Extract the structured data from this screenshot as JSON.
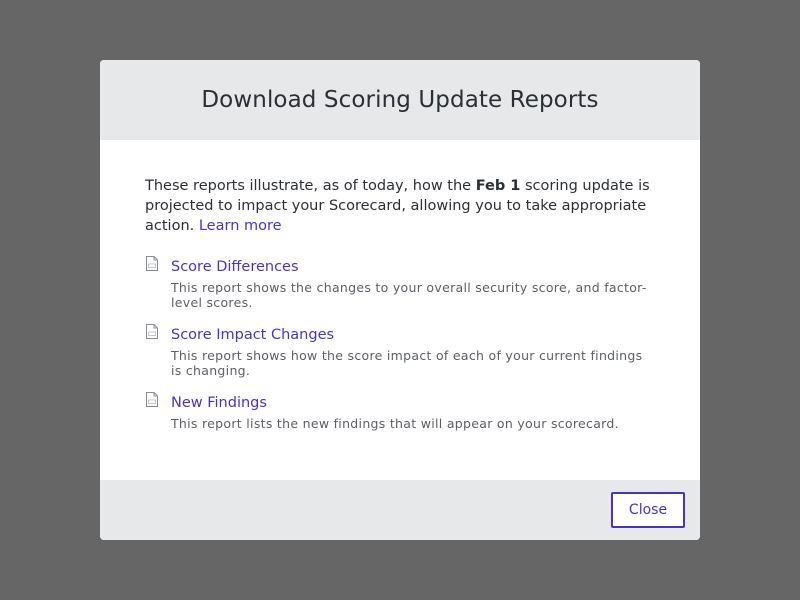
{
  "modal": {
    "title": "Download Scoring Update Reports",
    "intro_before": "These reports illustrate, as of today, how the ",
    "intro_bold": "Feb 1",
    "intro_after": " scoring update is projected to impact your Scorecard, allowing you to take appropriate action. ",
    "learn_more": "Learn more",
    "reports": [
      {
        "icon": "csv-file-icon",
        "label": "Score Differences",
        "description": "This report shows the changes to your overall security score, and factor-level scores."
      },
      {
        "icon": "csv-file-icon",
        "label": "Score Impact Changes",
        "description": "This report shows how the score impact of each of your current findings is changing."
      },
      {
        "icon": "csv-file-icon",
        "label": "New Findings",
        "description": "This report lists the new findings that will appear on your scorecard."
      }
    ],
    "close_label": "Close"
  },
  "colors": {
    "backdrop": "#666666",
    "header_footer": "#e7e8ea",
    "accent": "#4a32c8",
    "text": "#2b2f36",
    "muted_text": "#5b5f66"
  }
}
